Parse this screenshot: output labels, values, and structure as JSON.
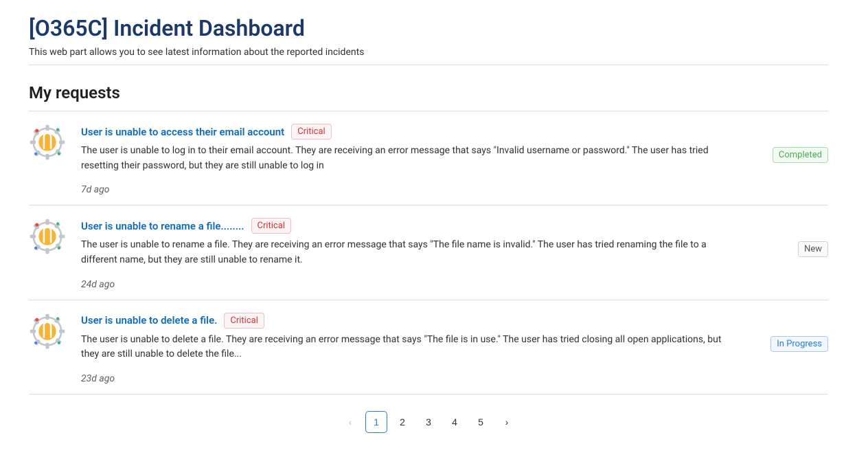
{
  "header": {
    "title": "[O365C] Incident Dashboard",
    "subtitle": "This web part allows you to see latest information about the reported incidents"
  },
  "section": {
    "title": "My requests"
  },
  "incidents": [
    {
      "title": "User is unable to access their email account",
      "severity": "Critical",
      "description": "The user is unable to log in to their email account. They are receiving an error message that says \"Invalid username or password.\" The user has tried resetting their password, but they are still unable to log in",
      "time": "7d ago",
      "status": "Completed"
    },
    {
      "title": "User is unable to rename a file........",
      "severity": "Critical",
      "description": "The user is unable to rename a file. They are receiving an error message that says \"The file name is invalid.\" The user has tried renaming the file to a different name, but they are still unable to rename it.",
      "time": "24d ago",
      "status": "New"
    },
    {
      "title": "User is unable to delete a file.",
      "severity": "Critical",
      "description": "The user is unable to delete a file. They are receiving an error message that says \"The file is in use.\" The user has tried closing all open applications, but they are still unable to delete the file...",
      "time": "23d ago",
      "status": "In Progress"
    }
  ],
  "status_styles": {
    "Completed": "badge-completed",
    "New": "badge-new",
    "In Progress": "badge-inprogress"
  },
  "severity_styles": {
    "Critical": "badge-critical"
  },
  "pagination": {
    "prev_disabled": true,
    "pages": [
      "1",
      "2",
      "3",
      "4",
      "5"
    ],
    "active": "1"
  }
}
